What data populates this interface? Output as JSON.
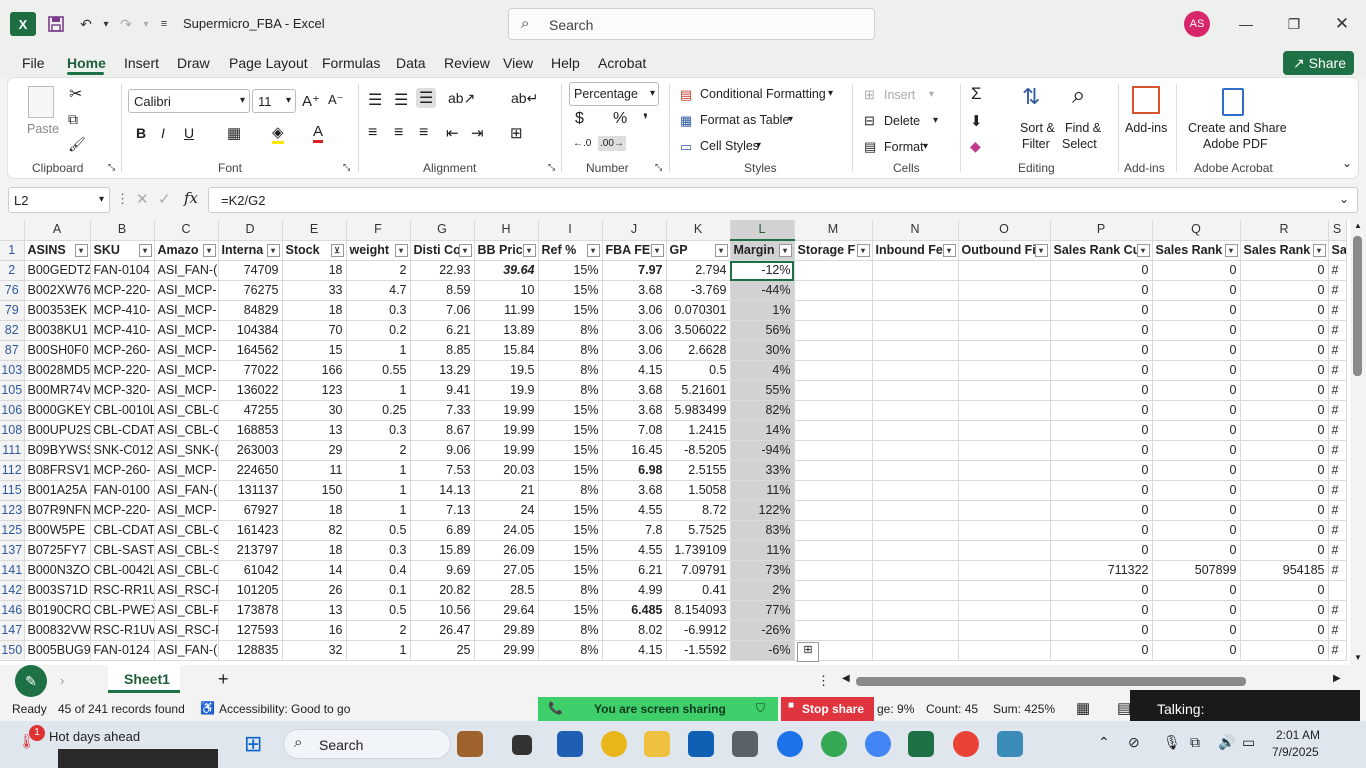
{
  "window": {
    "title": "Supermicro_FBA  -  Excel",
    "search_placeholder": "Search",
    "avatar_initials": "AS"
  },
  "menu": {
    "tabs": [
      "File",
      "Home",
      "Insert",
      "Draw",
      "Page Layout",
      "Formulas",
      "Data",
      "Review",
      "View",
      "Help",
      "Acrobat"
    ],
    "share_label": "Share"
  },
  "ribbon": {
    "clipboard": {
      "paste": "Paste",
      "label": "Clipboard"
    },
    "font": {
      "name": "Calibri",
      "size": "11",
      "label": "Font"
    },
    "alignment": {
      "label": "Alignment"
    },
    "number": {
      "format": "Percentage",
      "label": "Number"
    },
    "styles": {
      "conditional": "Conditional Formatting",
      "format_table": "Format as Table",
      "cell_styles": "Cell Styles",
      "label": "Styles"
    },
    "cells": {
      "insert": "Insert",
      "delete": "Delete",
      "format": "Format",
      "label": "Cells"
    },
    "editing": {
      "sort_filter": "Sort &",
      "sort_filter2": "Filter",
      "find_select": "Find &",
      "find_select2": "Select",
      "label": "Editing"
    },
    "addins": {
      "addins": "Add-ins",
      "label": "Add-ins"
    },
    "acrobat": {
      "create": "Create and Share",
      "create2": "Adobe PDF",
      "label": "Adobe Acrobat"
    }
  },
  "formula_bar": {
    "name_box": "L2",
    "formula": "=K2/G2"
  },
  "grid": {
    "col_letters": [
      "A",
      "B",
      "C",
      "D",
      "E",
      "F",
      "G",
      "H",
      "I",
      "J",
      "K",
      "L",
      "M",
      "N",
      "O",
      "P",
      "Q",
      "R",
      "S"
    ],
    "headers": [
      "ASINS",
      "SKU",
      "Amazo",
      "Interna",
      "Stock",
      "weight",
      "Disti Co",
      "BB Pric",
      "Ref %",
      "FBA FEI",
      "GP",
      "Margin",
      "Storage F",
      "Inbound Fe",
      "Outbound Fi",
      "Sales Rank Cu",
      "Sales Rank",
      "Sales Rank",
      "Sa"
    ],
    "rows": [
      {
        "n": "2",
        "c": [
          "B00GEDTZ",
          "FAN-0104",
          "ASI_FAN-(",
          "74709",
          "18",
          "2",
          "22.93",
          "39.64",
          "15%",
          "7.97",
          "2.794",
          "-12%",
          "",
          "",
          "",
          "0",
          "0",
          "0",
          "#"
        ]
      },
      {
        "n": "76",
        "c": [
          "B002XW76",
          "MCP-220-",
          "ASI_MCP-",
          "76275",
          "33",
          "4.7",
          "8.59",
          "10",
          "15%",
          "3.68",
          "-3.769",
          "-44%",
          "",
          "",
          "",
          "0",
          "0",
          "0",
          "#"
        ]
      },
      {
        "n": "79",
        "c": [
          "B00353EK",
          "MCP-410-",
          "ASI_MCP-",
          "84829",
          "18",
          "0.3",
          "7.06",
          "11.99",
          "15%",
          "3.06",
          "0.070301",
          "1%",
          "",
          "",
          "",
          "0",
          "0",
          "0",
          "#"
        ]
      },
      {
        "n": "82",
        "c": [
          "B0038KU1",
          "MCP-410-",
          "ASI_MCP-",
          "104384",
          "70",
          "0.2",
          "6.21",
          "13.89",
          "8%",
          "3.06",
          "3.506022",
          "56%",
          "",
          "",
          "",
          "0",
          "0",
          "0",
          "#"
        ]
      },
      {
        "n": "87",
        "c": [
          "B00SH0F0",
          "MCP-260-",
          "ASI_MCP-",
          "164562",
          "15",
          "1",
          "8.85",
          "15.84",
          "8%",
          "3.06",
          "2.6628",
          "30%",
          "",
          "",
          "",
          "0",
          "0",
          "0",
          "#"
        ]
      },
      {
        "n": "103",
        "c": [
          "B0028MD5",
          "MCP-220-",
          "ASI_MCP-",
          "77022",
          "166",
          "0.55",
          "13.29",
          "19.5",
          "8%",
          "4.15",
          "0.5",
          "4%",
          "",
          "",
          "",
          "0",
          "0",
          "0",
          "#"
        ]
      },
      {
        "n": "105",
        "c": [
          "B00MR74V",
          "MCP-320-",
          "ASI_MCP-",
          "136022",
          "123",
          "1",
          "9.41",
          "19.9",
          "8%",
          "3.68",
          "5.21601",
          "55%",
          "",
          "",
          "",
          "0",
          "0",
          "0",
          "#"
        ]
      },
      {
        "n": "106",
        "c": [
          "B000GKEY",
          "CBL-0010L",
          "ASI_CBL-0",
          "47255",
          "30",
          "0.25",
          "7.33",
          "19.99",
          "15%",
          "3.68",
          "5.983499",
          "82%",
          "",
          "",
          "",
          "0",
          "0",
          "0",
          "#"
        ]
      },
      {
        "n": "108",
        "c": [
          "B00UPU2S",
          "CBL-CDAT",
          "ASI_CBL-C",
          "168853",
          "13",
          "0.3",
          "8.67",
          "19.99",
          "15%",
          "7.08",
          "1.2415",
          "14%",
          "",
          "",
          "",
          "0",
          "0",
          "0",
          "#"
        ]
      },
      {
        "n": "111",
        "c": [
          "B09BYWSS",
          "SNK-C012",
          "ASI_SNK-(",
          "263003",
          "29",
          "2",
          "9.06",
          "19.99",
          "15%",
          "16.45",
          "-8.5205",
          "-94%",
          "",
          "",
          "",
          "0",
          "0",
          "0",
          "#"
        ]
      },
      {
        "n": "112",
        "c": [
          "B08FRSV1",
          "MCP-260-",
          "ASI_MCP-",
          "224650",
          "11",
          "1",
          "7.53",
          "20.03",
          "15%",
          "6.98",
          "2.5155",
          "33%",
          "",
          "",
          "",
          "0",
          "0",
          "0",
          "#"
        ]
      },
      {
        "n": "115",
        "c": [
          "B001A25A",
          "FAN-0100",
          "ASI_FAN-(",
          "131137",
          "150",
          "1",
          "14.13",
          "21",
          "8%",
          "3.68",
          "1.5058",
          "11%",
          "",
          "",
          "",
          "0",
          "0",
          "0",
          "#"
        ]
      },
      {
        "n": "123",
        "c": [
          "B07R9NFN",
          "MCP-220-",
          "ASI_MCP-",
          "67927",
          "18",
          "1",
          "7.13",
          "24",
          "15%",
          "4.55",
          "8.72",
          "122%",
          "",
          "",
          "",
          "0",
          "0",
          "0",
          "#"
        ]
      },
      {
        "n": "125",
        "c": [
          "B00W5PE",
          "CBL-CDAT",
          "ASI_CBL-C",
          "161423",
          "82",
          "0.5",
          "6.89",
          "24.05",
          "15%",
          "7.8",
          "5.7525",
          "83%",
          "",
          "",
          "",
          "0",
          "0",
          "0",
          "#"
        ]
      },
      {
        "n": "137",
        "c": [
          "B0725FY7",
          "CBL-SAST-",
          "ASI_CBL-S",
          "213797",
          "18",
          "0.3",
          "15.89",
          "26.09",
          "15%",
          "4.55",
          "1.739109",
          "11%",
          "",
          "",
          "",
          "0",
          "0",
          "0",
          "#"
        ]
      },
      {
        "n": "141",
        "c": [
          "B000N3ZO",
          "CBL-0042L",
          "ASI_CBL-0",
          "61042",
          "14",
          "0.4",
          "9.69",
          "27.05",
          "15%",
          "6.21",
          "7.09791",
          "73%",
          "",
          "",
          "",
          "711322",
          "507899",
          "954185",
          "#"
        ]
      },
      {
        "n": "142",
        "c": [
          "B003S71D",
          "RSC-RR1U",
          "ASI_RSC-R",
          "101205",
          "26",
          "0.1",
          "20.82",
          "28.5",
          "8%",
          "4.99",
          "0.41",
          "2%",
          "",
          "",
          "",
          "0",
          "0",
          "0",
          ""
        ]
      },
      {
        "n": "146",
        "c": [
          "B0190CRO",
          "CBL-PWEX",
          "ASI_CBL-P",
          "173878",
          "13",
          "0.5",
          "10.56",
          "29.64",
          "15%",
          "6.485",
          "8.154093",
          "77%",
          "",
          "",
          "",
          "0",
          "0",
          "0",
          "#"
        ]
      },
      {
        "n": "147",
        "c": [
          "B00832VW",
          "RSC-R1UW",
          "ASI_RSC-R",
          "127593",
          "16",
          "2",
          "26.47",
          "29.89",
          "8%",
          "8.02",
          "-6.9912",
          "-26%",
          "",
          "",
          "",
          "0",
          "0",
          "0",
          "#"
        ]
      },
      {
        "n": "150",
        "c": [
          "B005BUG9",
          "FAN-0124",
          "ASI_FAN-(",
          "128835",
          "32",
          "1",
          "25",
          "29.99",
          "8%",
          "4.15",
          "-1.5592",
          "-6%",
          "",
          "",
          "",
          "0",
          "0",
          "0",
          "#"
        ]
      }
    ]
  },
  "sheet_tabs": {
    "active": "Sheet1"
  },
  "status": {
    "ready": "Ready",
    "records": "45 of 241 records found",
    "accessibility": "Accessibility: Good to go",
    "screen_sharing": "You are screen sharing",
    "stop_share": "Stop share",
    "avg": "ge: 9%",
    "count": "Count: 45",
    "sum": "Sum: 425%",
    "talking": "Talking:"
  },
  "taskbar": {
    "weather": "Hot days ahead",
    "weather_badge": "1",
    "search": "Search",
    "time": "2:01 AM",
    "date": "7/9/2025"
  },
  "colors": {
    "excel_green": "#1f6e43",
    "share_green": "#1e7145",
    "screen_share": "#3fcf6a",
    "stop_red": "#e0353f"
  }
}
